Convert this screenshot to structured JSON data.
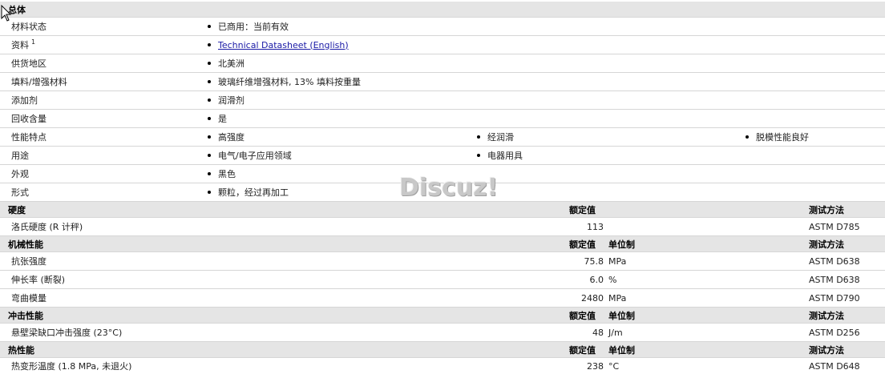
{
  "general": {
    "title": "总体",
    "rows": [
      {
        "label": "材料状态",
        "values": [
          "已商用：当前有效"
        ]
      },
      {
        "label": "资料",
        "sup": "1",
        "values": [
          "Technical Datasheet (English)"
        ],
        "link": true
      },
      {
        "label": "供货地区",
        "values": [
          "北美洲"
        ]
      },
      {
        "label": "填料/增强材料",
        "values": [
          "玻璃纤维增强材料, 13% 填料按重量"
        ]
      },
      {
        "label": "添加剂",
        "values": [
          "润滑剂"
        ]
      },
      {
        "label": "回收含量",
        "values": [
          "是"
        ]
      },
      {
        "label": "性能特点",
        "values": [
          "高强度",
          "经润滑",
          "脱模性能良好"
        ]
      },
      {
        "label": "用途",
        "values": [
          "电气/电子应用领域",
          "电器用具"
        ]
      },
      {
        "label": "外观",
        "values": [
          "黑色"
        ]
      },
      {
        "label": "形式",
        "values": [
          "颗粒，经过再加工"
        ]
      }
    ]
  },
  "sections": [
    {
      "title": "硬度",
      "col_value": "额定值",
      "col_unit": "",
      "col_method": "测试方法",
      "rows": [
        {
          "label": "洛氏硬度 (R 计秤)",
          "value": "113",
          "unit": "",
          "method": "ASTM D785"
        }
      ]
    },
    {
      "title": "机械性能",
      "col_value": "额定值",
      "col_unit": "单位制",
      "col_method": "测试方法",
      "rows": [
        {
          "label": "抗张强度",
          "value": "75.8",
          "unit": "MPa",
          "method": "ASTM D638"
        },
        {
          "label": "伸长率 (断裂)",
          "value": "6.0",
          "unit": "%",
          "method": "ASTM D638"
        },
        {
          "label": "弯曲模量",
          "value": "2480",
          "unit": "MPa",
          "method": "ASTM D790"
        }
      ]
    },
    {
      "title": "冲击性能",
      "col_value": "额定值",
      "col_unit": "单位制",
      "col_method": "测试方法",
      "rows": [
        {
          "label": "悬壁梁缺口冲击强度 (23°C)",
          "value": "48",
          "unit": "J/m",
          "method": "ASTM D256"
        }
      ]
    },
    {
      "title": "热性能",
      "col_value": "额定值",
      "col_unit": "单位制",
      "col_method": "测试方法",
      "rows": [
        {
          "label": "热变形温度 (1.8 MPa, 未退火)",
          "value": "238",
          "unit": "°C",
          "method": "ASTM D648"
        }
      ]
    }
  ],
  "watermark": "Discuz!"
}
